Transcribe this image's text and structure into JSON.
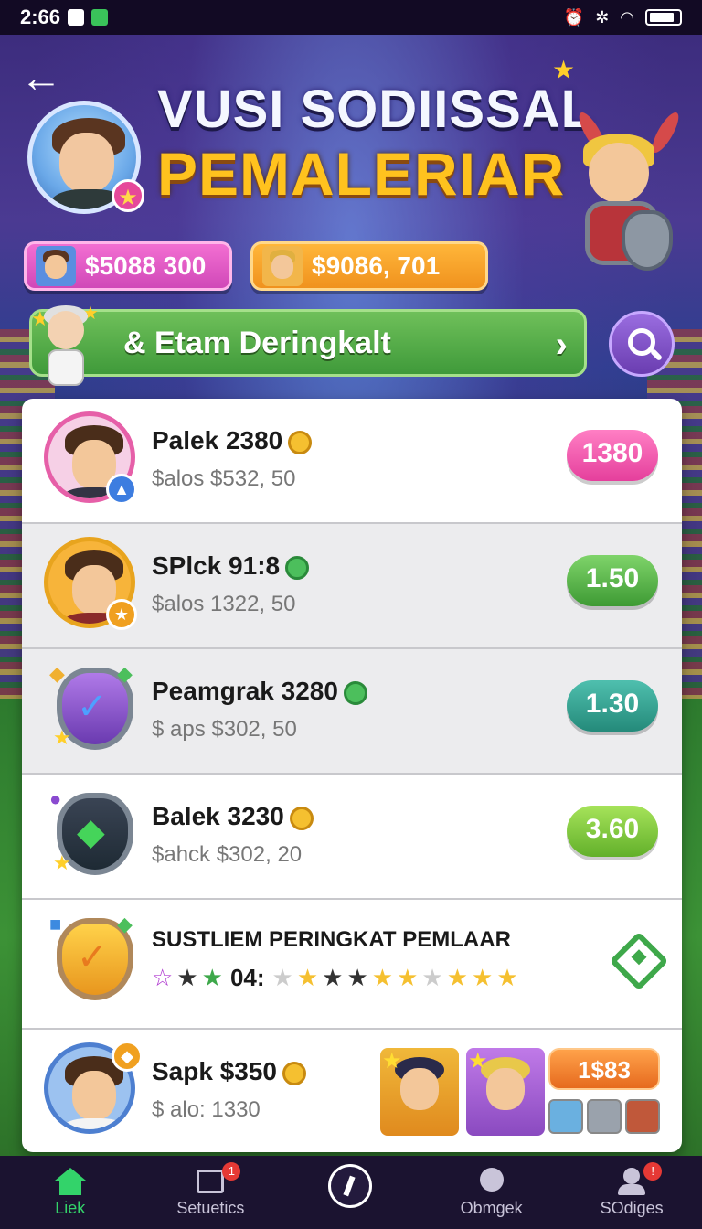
{
  "status_bar": {
    "time": "2:66"
  },
  "header": {
    "title_line1": "VUSI SODIISSAL",
    "title_line2": "PEMALERIAR"
  },
  "currencies": [
    {
      "value": "$5088 300",
      "color": "#e04bbd"
    },
    {
      "value": "$9086, 701",
      "color": "#f2a12c"
    }
  ],
  "banner": {
    "label": "& Etam Deringkalt"
  },
  "list": {
    "rows": [
      {
        "name": "Palek 2380",
        "sub": "$alos $532, 50",
        "pill": "1380",
        "pill_color": "#e53f9c"
      },
      {
        "name": "SPlck 91:8",
        "sub": "$alos 1322, 50",
        "pill": "1.50",
        "pill_color": "#3e9a34"
      },
      {
        "name": "Peamgrak 3280",
        "sub": "$ aps $302, 50",
        "pill": "1.30",
        "pill_color": "#248a7a"
      },
      {
        "name": "Balek 3230",
        "sub": "$ahck $302, 20",
        "pill": "3.60",
        "pill_color": "#62b02a"
      }
    ],
    "rank_row": {
      "title": "SUSTLIEM PERINGKAT PEMLAAR",
      "code": "04:"
    },
    "last_row": {
      "name": "Sapk $350",
      "sub": "$ alo: 1330",
      "price": "1$83"
    }
  },
  "bottom_nav": {
    "items": [
      {
        "label": "Liek",
        "icon": "home-icon"
      },
      {
        "label": "Setuetics",
        "icon": "stats-icon",
        "badge": "1"
      },
      {
        "label": "",
        "icon": "center-action-icon"
      },
      {
        "label": "Obmgek",
        "icon": "chat-icon"
      },
      {
        "label": "SOdiges",
        "icon": "profile-icon",
        "badge": "!"
      }
    ]
  }
}
